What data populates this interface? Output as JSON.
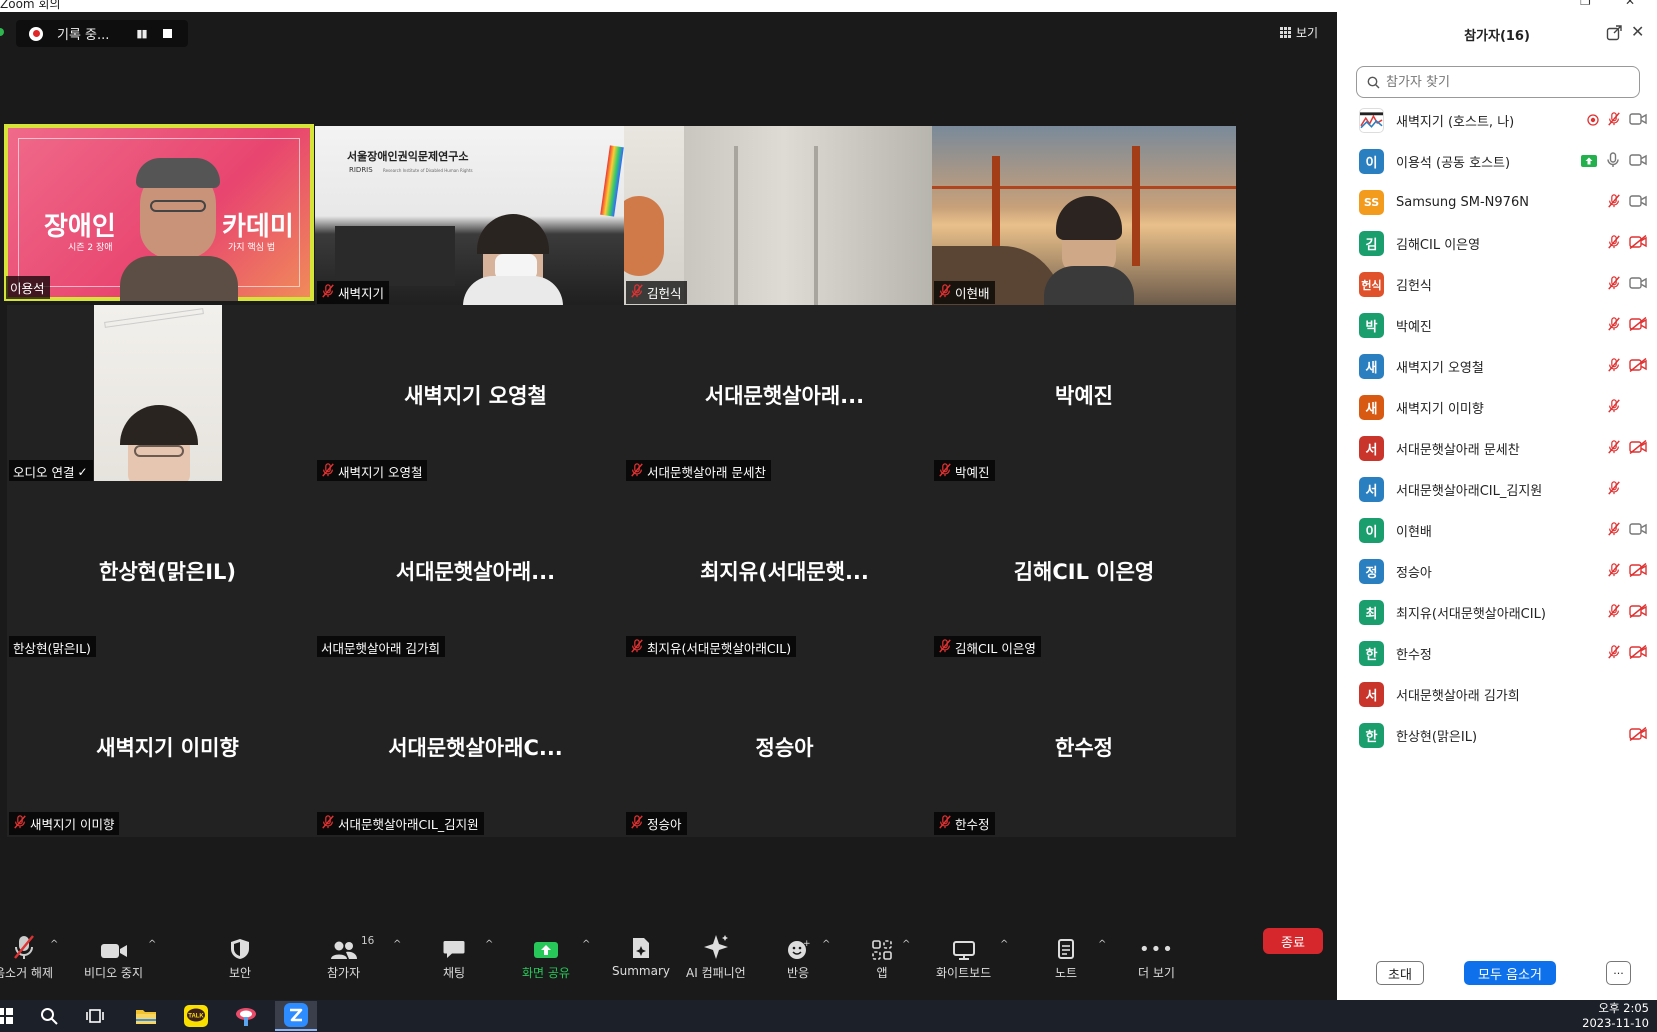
{
  "window": {
    "title": "Zoom 회의"
  },
  "recording": {
    "label": "기록 중..."
  },
  "view_button": {
    "label": "보기"
  },
  "tiles": [
    {
      "big": "",
      "tag": "이용석",
      "muted": false,
      "video": "slide"
    },
    {
      "big": "",
      "tag": "새벽지기",
      "muted": true,
      "video": "office"
    },
    {
      "big": "",
      "tag": "김헌식",
      "muted": true,
      "video": "wall"
    },
    {
      "big": "",
      "tag": "이현배",
      "muted": true,
      "video": "bridge"
    },
    {
      "big": "",
      "tag": "오디오 연결",
      "muted": false,
      "video": "portrait"
    },
    {
      "big": "새벽지기 오영철",
      "tag": "새벽지기 오영철",
      "muted": true
    },
    {
      "big": "서대문햇살아래...",
      "tag": "서대문햇살아래 문세찬",
      "muted": true
    },
    {
      "big": "박예진",
      "tag": "박예진",
      "muted": true
    },
    {
      "big": "한상현(맑은IL)",
      "tag": "한상현(맑은IL)",
      "muted": false
    },
    {
      "big": "서대문햇살아래...",
      "tag": "서대문햇살아래 김가희",
      "muted": false
    },
    {
      "big": "최지유(서대문햇...",
      "tag": "최지유(서대문햇살아래CIL)",
      "muted": true
    },
    {
      "big": "김해CIL 이은영",
      "tag": "김해CIL 이은영",
      "muted": true
    },
    {
      "big": "새벽지기 이미향",
      "tag": "새벽지기 이미향",
      "muted": true
    },
    {
      "big": "서대문햇살아래C...",
      "tag": "서대문햇살아래CIL_김지원",
      "muted": true
    },
    {
      "big": "정승아",
      "tag": "정승아",
      "muted": true
    },
    {
      "big": "한수정",
      "tag": "한수정",
      "muted": true
    }
  ],
  "slide": {
    "title_left": "장애인",
    "title_right": "카데미",
    "subtitle": "시즌 2 장애",
    "subtitle2": "가지 핵심 법"
  },
  "office": {
    "org": "서울장애인권익문제연구소",
    "abbr": "RIDRIS",
    "sub": "Research Institute of Disabled Human Rights"
  },
  "toolbar": {
    "mute": "음소거 해제",
    "video": "비디오 중지",
    "security": "보안",
    "participants": "참가자",
    "participants_count": "16",
    "chat": "채팅",
    "share": "화면 공유",
    "summary": "Summary",
    "ai": "AI 컴패니언",
    "reactions": "반응",
    "apps": "앱",
    "whiteboard": "화이트보드",
    "notes": "노트",
    "more": "더 보기",
    "end": "종료"
  },
  "panel": {
    "title": "참가자(16)",
    "search_placeholder": "참가자 찾기",
    "invite": "초대",
    "mute_all": "모두 음소거",
    "more": "···",
    "participants": [
      {
        "avatar": "",
        "color": "#ffffff",
        "name": "새벽지기 (호스트, 나)",
        "mic": "muted",
        "cam": "on",
        "extra": "rec"
      },
      {
        "avatar": "이",
        "color": "#2a7fc1",
        "name": "이용석 (공동 호스트)",
        "mic": "on",
        "cam": "on",
        "extra": "share"
      },
      {
        "avatar": "SS",
        "color": "#f29b1d",
        "name": "Samsung SM-N976N",
        "mic": "muted",
        "cam": "on"
      },
      {
        "avatar": "김",
        "color": "#1a9e6e",
        "name": "김해CIL 이은영",
        "mic": "muted",
        "cam": "off"
      },
      {
        "avatar": "헌식",
        "color": "#e0522b",
        "name": "김헌식",
        "mic": "muted",
        "cam": "on"
      },
      {
        "avatar": "박",
        "color": "#1a9e6e",
        "name": "박예진",
        "mic": "muted",
        "cam": "off"
      },
      {
        "avatar": "새",
        "color": "#2a7fc1",
        "name": "새벽지기 오영철",
        "mic": "muted",
        "cam": "off"
      },
      {
        "avatar": "새",
        "color": "#d85a12",
        "name": "새벽지기 이미향",
        "mic": "muted",
        "cam": "none"
      },
      {
        "avatar": "서",
        "color": "#c9352b",
        "name": "서대문햇살아래 문세찬",
        "mic": "muted",
        "cam": "off"
      },
      {
        "avatar": "서",
        "color": "#2a7fc1",
        "name": "서대문햇살아래CIL_김지원",
        "mic": "muted",
        "cam": "none"
      },
      {
        "avatar": "이",
        "color": "#1a9e6e",
        "name": "이현배",
        "mic": "muted",
        "cam": "on"
      },
      {
        "avatar": "정",
        "color": "#2a7fc1",
        "name": "정승아",
        "mic": "muted",
        "cam": "off"
      },
      {
        "avatar": "최",
        "color": "#1a9e6e",
        "name": "최지유(서대문햇살아래CIL)",
        "mic": "muted",
        "cam": "off"
      },
      {
        "avatar": "한",
        "color": "#1a9e6e",
        "name": "한수정",
        "mic": "muted",
        "cam": "off"
      },
      {
        "avatar": "서",
        "color": "#c9352b",
        "name": "서대문햇살아래 김가희",
        "mic": "none",
        "cam": "none"
      },
      {
        "avatar": "한",
        "color": "#1a9e6e",
        "name": "한상현(맑은IL)",
        "mic": "none",
        "cam": "off"
      }
    ]
  },
  "taskbar": {
    "time": "오후 2:05",
    "date": "2023-11-10",
    "kakao": "TALK"
  }
}
